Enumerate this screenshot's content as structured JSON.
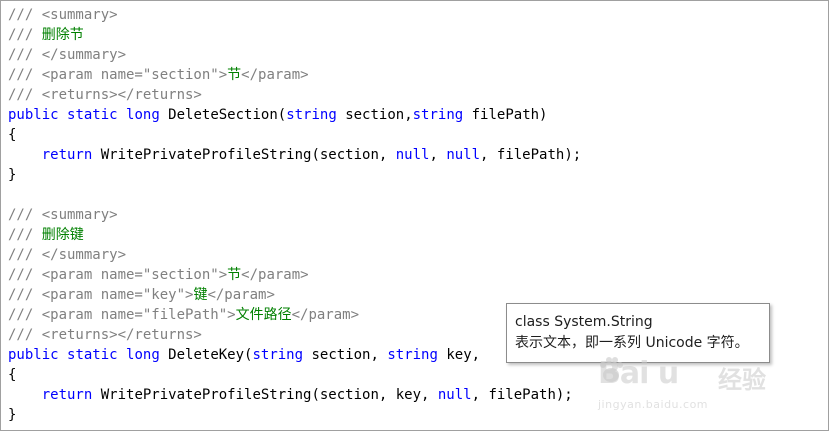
{
  "code_lines": [
    {
      "kind": "doc",
      "parts": [
        {
          "t": "/// ",
          "c": "doc"
        },
        {
          "t": "<summary>",
          "c": "doc"
        }
      ]
    },
    {
      "kind": "doc",
      "parts": [
        {
          "t": "/// ",
          "c": "doc"
        },
        {
          "t": "删除节",
          "c": "com"
        }
      ]
    },
    {
      "kind": "doc",
      "parts": [
        {
          "t": "/// ",
          "c": "doc"
        },
        {
          "t": "</summary>",
          "c": "doc"
        }
      ]
    },
    {
      "kind": "doc",
      "parts": [
        {
          "t": "/// ",
          "c": "doc"
        },
        {
          "t": "<param name=\"section\">",
          "c": "doc"
        },
        {
          "t": "节",
          "c": "com"
        },
        {
          "t": "</param>",
          "c": "doc"
        }
      ]
    },
    {
      "kind": "doc",
      "parts": [
        {
          "t": "/// ",
          "c": "doc"
        },
        {
          "t": "<returns></returns>",
          "c": "doc"
        }
      ]
    },
    {
      "kind": "code",
      "parts": [
        {
          "t": "public",
          "c": "kw"
        },
        {
          "t": " ",
          "c": "plain"
        },
        {
          "t": "static",
          "c": "kw"
        },
        {
          "t": " ",
          "c": "plain"
        },
        {
          "t": "long",
          "c": "kw"
        },
        {
          "t": " DeleteSection(",
          "c": "plain"
        },
        {
          "t": "string",
          "c": "kw"
        },
        {
          "t": " section,",
          "c": "plain"
        },
        {
          "t": "string",
          "c": "kw"
        },
        {
          "t": " filePath)",
          "c": "plain"
        }
      ]
    },
    {
      "kind": "code",
      "parts": [
        {
          "t": "{",
          "c": "plain"
        }
      ]
    },
    {
      "kind": "code",
      "parts": [
        {
          "t": "    ",
          "c": "plain"
        },
        {
          "t": "return",
          "c": "kw"
        },
        {
          "t": " WritePrivateProfileString(section, ",
          "c": "plain"
        },
        {
          "t": "null",
          "c": "kw"
        },
        {
          "t": ", ",
          "c": "plain"
        },
        {
          "t": "null",
          "c": "kw"
        },
        {
          "t": ", filePath);",
          "c": "plain"
        }
      ]
    },
    {
      "kind": "code",
      "parts": [
        {
          "t": "}",
          "c": "plain"
        }
      ]
    },
    {
      "kind": "blank",
      "parts": [
        {
          "t": " ",
          "c": "plain"
        }
      ]
    },
    {
      "kind": "doc",
      "parts": [
        {
          "t": "/// ",
          "c": "doc"
        },
        {
          "t": "<summary>",
          "c": "doc"
        }
      ]
    },
    {
      "kind": "doc",
      "parts": [
        {
          "t": "/// ",
          "c": "doc"
        },
        {
          "t": "删除键",
          "c": "com"
        }
      ]
    },
    {
      "kind": "doc",
      "parts": [
        {
          "t": "/// ",
          "c": "doc"
        },
        {
          "t": "</summary>",
          "c": "doc"
        }
      ]
    },
    {
      "kind": "doc",
      "parts": [
        {
          "t": "/// ",
          "c": "doc"
        },
        {
          "t": "<param name=\"section\">",
          "c": "doc"
        },
        {
          "t": "节",
          "c": "com"
        },
        {
          "t": "</param>",
          "c": "doc"
        }
      ]
    },
    {
      "kind": "doc",
      "parts": [
        {
          "t": "/// ",
          "c": "doc"
        },
        {
          "t": "<param name=\"key\">",
          "c": "doc"
        },
        {
          "t": "键",
          "c": "com"
        },
        {
          "t": "</param>",
          "c": "doc"
        }
      ]
    },
    {
      "kind": "doc",
      "parts": [
        {
          "t": "/// ",
          "c": "doc"
        },
        {
          "t": "<param name=\"filePath\">",
          "c": "doc"
        },
        {
          "t": "文件路径",
          "c": "com"
        },
        {
          "t": "</param>",
          "c": "doc"
        }
      ]
    },
    {
      "kind": "doc",
      "parts": [
        {
          "t": "/// ",
          "c": "doc"
        },
        {
          "t": "<returns></returns>",
          "c": "doc"
        }
      ]
    },
    {
      "kind": "code",
      "parts": [
        {
          "t": "public",
          "c": "kw"
        },
        {
          "t": " ",
          "c": "plain"
        },
        {
          "t": "static",
          "c": "kw"
        },
        {
          "t": " ",
          "c": "plain"
        },
        {
          "t": "long",
          "c": "kw"
        },
        {
          "t": " DeleteKey(",
          "c": "plain"
        },
        {
          "t": "string",
          "c": "kw"
        },
        {
          "t": " section, ",
          "c": "plain"
        },
        {
          "t": "string",
          "c": "kw"
        },
        {
          "t": " key,",
          "c": "plain"
        }
      ]
    },
    {
      "kind": "code",
      "parts": [
        {
          "t": "{",
          "c": "plain"
        }
      ]
    },
    {
      "kind": "code",
      "parts": [
        {
          "t": "    ",
          "c": "plain"
        },
        {
          "t": "return",
          "c": "kw"
        },
        {
          "t": " WritePrivateProfileString(section, key, ",
          "c": "plain"
        },
        {
          "t": "null",
          "c": "kw"
        },
        {
          "t": ", filePath);",
          "c": "plain"
        }
      ]
    },
    {
      "kind": "code",
      "parts": [
        {
          "t": "}",
          "c": "plain"
        }
      ]
    }
  ],
  "tooltip": {
    "line1": "class System.String",
    "line2": "表示文本，即一系列 Unicode 字符。"
  },
  "watermark": {
    "logo": "Bai  u",
    "sub": "经验",
    "url": "jingyan.baidu.com"
  },
  "colors": {
    "keyword": "#0000ff",
    "doc_comment": "#808080",
    "comment_text": "#008000",
    "plain": "#000000"
  }
}
